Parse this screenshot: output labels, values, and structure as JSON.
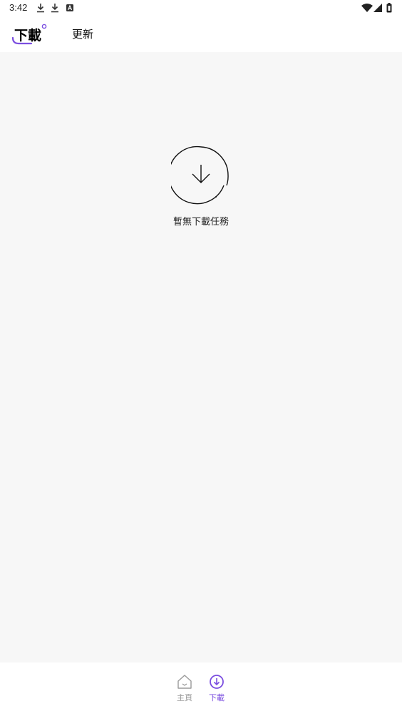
{
  "status_bar": {
    "time": "3:42"
  },
  "top_tabs": {
    "active": "下載",
    "inactive": "更新",
    "accent_color": "#7b4ee0"
  },
  "empty_state": {
    "icon": "download-circle-icon",
    "message": "暫無下載任務"
  },
  "bottom_nav": {
    "items": [
      {
        "label": "主頁",
        "icon": "home-icon",
        "active": false
      },
      {
        "label": "下載",
        "icon": "download-circle-icon",
        "active": true
      }
    ],
    "active_color": "#7b4ee0",
    "inactive_color": "#9a9a9a"
  }
}
